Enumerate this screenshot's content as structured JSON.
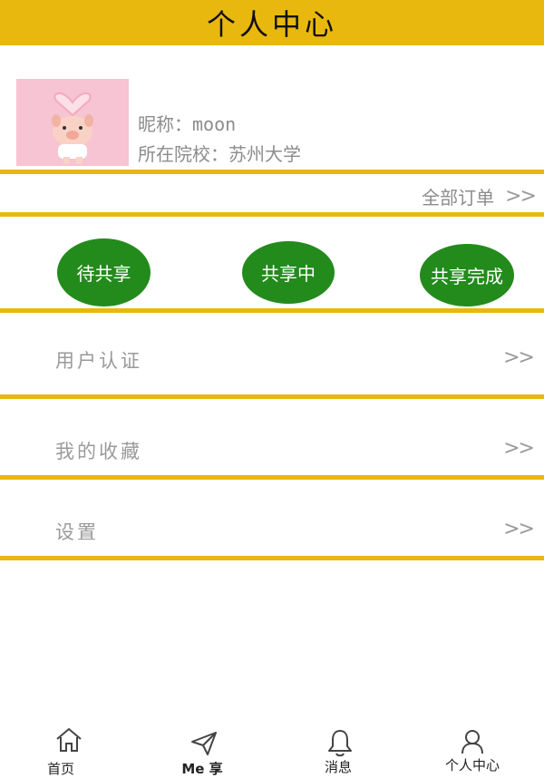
{
  "header": {
    "title": "个人中心"
  },
  "profile": {
    "nickname_label": "昵称：",
    "nickname": "moon",
    "school_label": "所在院校：",
    "school": "苏州大学",
    "avatar_icon": "pig-avatar-image"
  },
  "orders": {
    "all_label": "全部订单",
    "chevron": ">>"
  },
  "status_buttons": [
    {
      "label": "待共享"
    },
    {
      "label": "共享中"
    },
    {
      "label": "共享完成"
    }
  ],
  "menu": [
    {
      "label": "用户认证",
      "chevron": ">>"
    },
    {
      "label": "我的收藏",
      "chevron": ">>"
    },
    {
      "label": "设置",
      "chevron": ">>"
    }
  ],
  "tabbar": [
    {
      "label": "首页",
      "icon": "home-icon"
    },
    {
      "label": "Me 享",
      "icon": "paper-plane-icon"
    },
    {
      "label": "消息",
      "icon": "bell-icon"
    },
    {
      "label": "个人中心",
      "icon": "user-icon"
    }
  ],
  "colors": {
    "accent": "#e9b80f",
    "button_green": "#238b1c",
    "text_gray": "#8c8c8c"
  }
}
